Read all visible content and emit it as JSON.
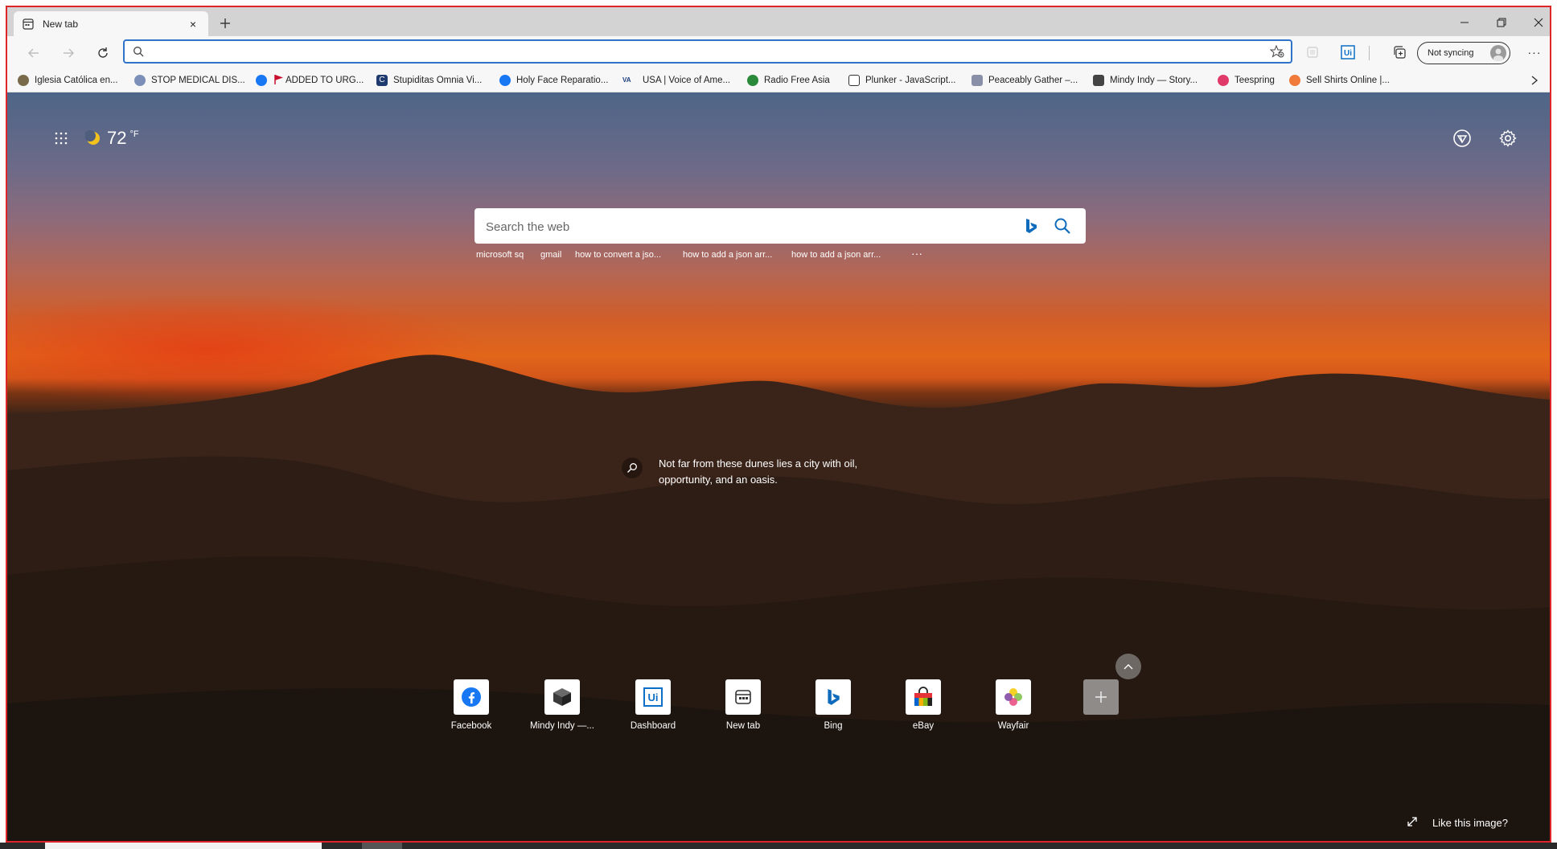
{
  "window": {
    "tab_title": "New tab",
    "tab_close": "×",
    "new_tab": "+"
  },
  "toolbar": {
    "address_value": "",
    "address_placeholder": "",
    "sync_label": "Not syncing",
    "more_label": "···"
  },
  "bookmarks": [
    {
      "label": "Iglesia Católica en...",
      "icon": "globe-icon",
      "color": "#7a6a4c"
    },
    {
      "label": "STOP MEDICAL DIS...",
      "icon": "site-icon",
      "color": "#7b8fb8"
    },
    {
      "label": "",
      "icon": "facebook-icon",
      "color": "#1877f2"
    },
    {
      "label": "ADDED TO URG...",
      "icon": "flag-icon",
      "color": "#c8102e"
    },
    {
      "label": "Stupiditas Omnia Vi...",
      "icon": "c-icon",
      "color": "#1f3a6e"
    },
    {
      "label": "Holy Face Reparatio...",
      "icon": "facebook-icon",
      "color": "#1877f2"
    },
    {
      "label": "USA | Voice of Ame...",
      "icon": "voa-icon",
      "color": "#1a3d7c"
    },
    {
      "label": "Radio Free Asia",
      "icon": "rfa-icon",
      "color": "#2a8a3a"
    },
    {
      "label": "Plunker - JavaScript...",
      "icon": "plunker-icon",
      "color": "#333333"
    },
    {
      "label": "Peaceably Gather –...",
      "icon": "site-icon",
      "color": "#8a8fa8"
    },
    {
      "label": "Mindy Indy — Story...",
      "icon": "cube-icon",
      "color": "#444444"
    },
    {
      "label": "Teespring",
      "icon": "teespring-icon",
      "color": "#e03a6a"
    },
    {
      "label": "Sell Shirts Online |...",
      "icon": "shirt-icon",
      "color": "#f07a3a"
    }
  ],
  "ntp": {
    "temperature": "72",
    "temp_unit": "°F",
    "search_placeholder": "Search the web",
    "search_value": "",
    "suggestions": [
      "microsoft sq",
      "gmail",
      "how to convert a jso...",
      "how to add a json arr...",
      "how to add a json arr...",
      "···"
    ],
    "caption": "Not far from these dunes lies a city with oil, opportunity, and an oasis.",
    "quick_links": [
      {
        "label": "Facebook",
        "icon": "facebook-icon"
      },
      {
        "label": "Mindy Indy —...",
        "icon": "cube-icon"
      },
      {
        "label": "Dashboard",
        "icon": "uipath-icon"
      },
      {
        "label": "New tab",
        "icon": "new-tab-icon"
      },
      {
        "label": "Bing",
        "icon": "bing-icon"
      },
      {
        "label": "eBay",
        "icon": "ebay-icon"
      },
      {
        "label": "Wayfair",
        "icon": "wayfair-icon"
      }
    ],
    "like_image": "Like this image?"
  },
  "colors": {
    "address_border": "#2f74c8",
    "frame_border": "#e0242b",
    "bing_blue": "#0f6cbd"
  }
}
